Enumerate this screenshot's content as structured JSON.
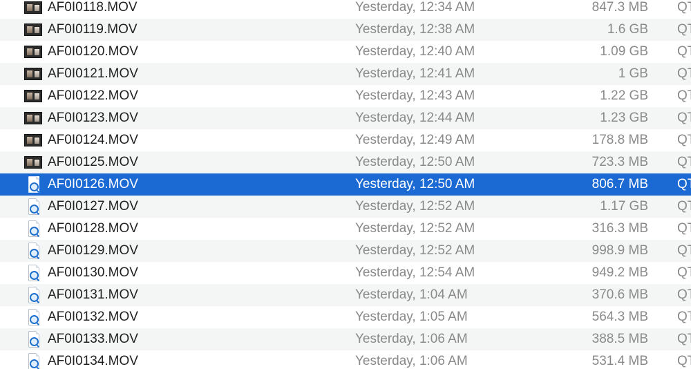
{
  "file_list": {
    "rows": [
      {
        "name": "AF0I0118.MOV",
        "date": "Yesterday, 12:34 AM",
        "size": "847.3 MB",
        "kind": "QT",
        "icon": "video-thumbnail-icon",
        "selected": false
      },
      {
        "name": "AF0I0119.MOV",
        "date": "Yesterday, 12:38 AM",
        "size": "1.6 GB",
        "kind": "QT",
        "icon": "video-thumbnail-icon",
        "selected": false
      },
      {
        "name": "AF0I0120.MOV",
        "date": "Yesterday, 12:40 AM",
        "size": "1.09 GB",
        "kind": "QT",
        "icon": "video-thumbnail-icon",
        "selected": false
      },
      {
        "name": "AF0I0121.MOV",
        "date": "Yesterday, 12:41 AM",
        "size": "1 GB",
        "kind": "QT",
        "icon": "video-thumbnail-icon",
        "selected": false
      },
      {
        "name": "AF0I0122.MOV",
        "date": "Yesterday, 12:43 AM",
        "size": "1.22 GB",
        "kind": "QT",
        "icon": "video-thumbnail-icon",
        "selected": false
      },
      {
        "name": "AF0I0123.MOV",
        "date": "Yesterday, 12:44 AM",
        "size": "1.23 GB",
        "kind": "QT",
        "icon": "video-thumbnail-icon",
        "selected": false
      },
      {
        "name": "AF0I0124.MOV",
        "date": "Yesterday, 12:49 AM",
        "size": "178.8 MB",
        "kind": "QT",
        "icon": "video-thumbnail-icon",
        "selected": false
      },
      {
        "name": "AF0I0125.MOV",
        "date": "Yesterday, 12:50 AM",
        "size": "723.3 MB",
        "kind": "QT",
        "icon": "video-thumbnail-icon",
        "selected": false
      },
      {
        "name": "AF0I0126.MOV",
        "date": "Yesterday, 12:50 AM",
        "size": "806.7 MB",
        "kind": "QT",
        "icon": "quicktime-document-icon",
        "selected": true
      },
      {
        "name": "AF0I0127.MOV",
        "date": "Yesterday, 12:52 AM",
        "size": "1.17 GB",
        "kind": "QT",
        "icon": "quicktime-document-icon",
        "selected": false
      },
      {
        "name": "AF0I0128.MOV",
        "date": "Yesterday, 12:52 AM",
        "size": "316.3 MB",
        "kind": "QT",
        "icon": "quicktime-document-icon",
        "selected": false
      },
      {
        "name": "AF0I0129.MOV",
        "date": "Yesterday, 12:52 AM",
        "size": "998.9 MB",
        "kind": "QT",
        "icon": "quicktime-document-icon",
        "selected": false
      },
      {
        "name": "AF0I0130.MOV",
        "date": "Yesterday, 12:54 AM",
        "size": "949.2 MB",
        "kind": "QT",
        "icon": "quicktime-document-icon",
        "selected": false
      },
      {
        "name": "AF0I0131.MOV",
        "date": "Yesterday, 1:04 AM",
        "size": "370.6 MB",
        "kind": "QT",
        "icon": "quicktime-document-icon",
        "selected": false
      },
      {
        "name": "AF0I0132.MOV",
        "date": "Yesterday, 1:05 AM",
        "size": "564.3 MB",
        "kind": "QT",
        "icon": "quicktime-document-icon",
        "selected": false
      },
      {
        "name": "AF0I0133.MOV",
        "date": "Yesterday, 1:06 AM",
        "size": "388.5 MB",
        "kind": "QT",
        "icon": "quicktime-document-icon",
        "selected": false
      },
      {
        "name": "AF0I0134.MOV",
        "date": "Yesterday, 1:06 AM",
        "size": "531.4 MB",
        "kind": "QT",
        "icon": "quicktime-document-icon",
        "selected": false
      }
    ]
  },
  "colors": {
    "selection": "#1b69d3",
    "alt_row": "#f4f5f5",
    "secondary_text": "#8a8a8a"
  }
}
